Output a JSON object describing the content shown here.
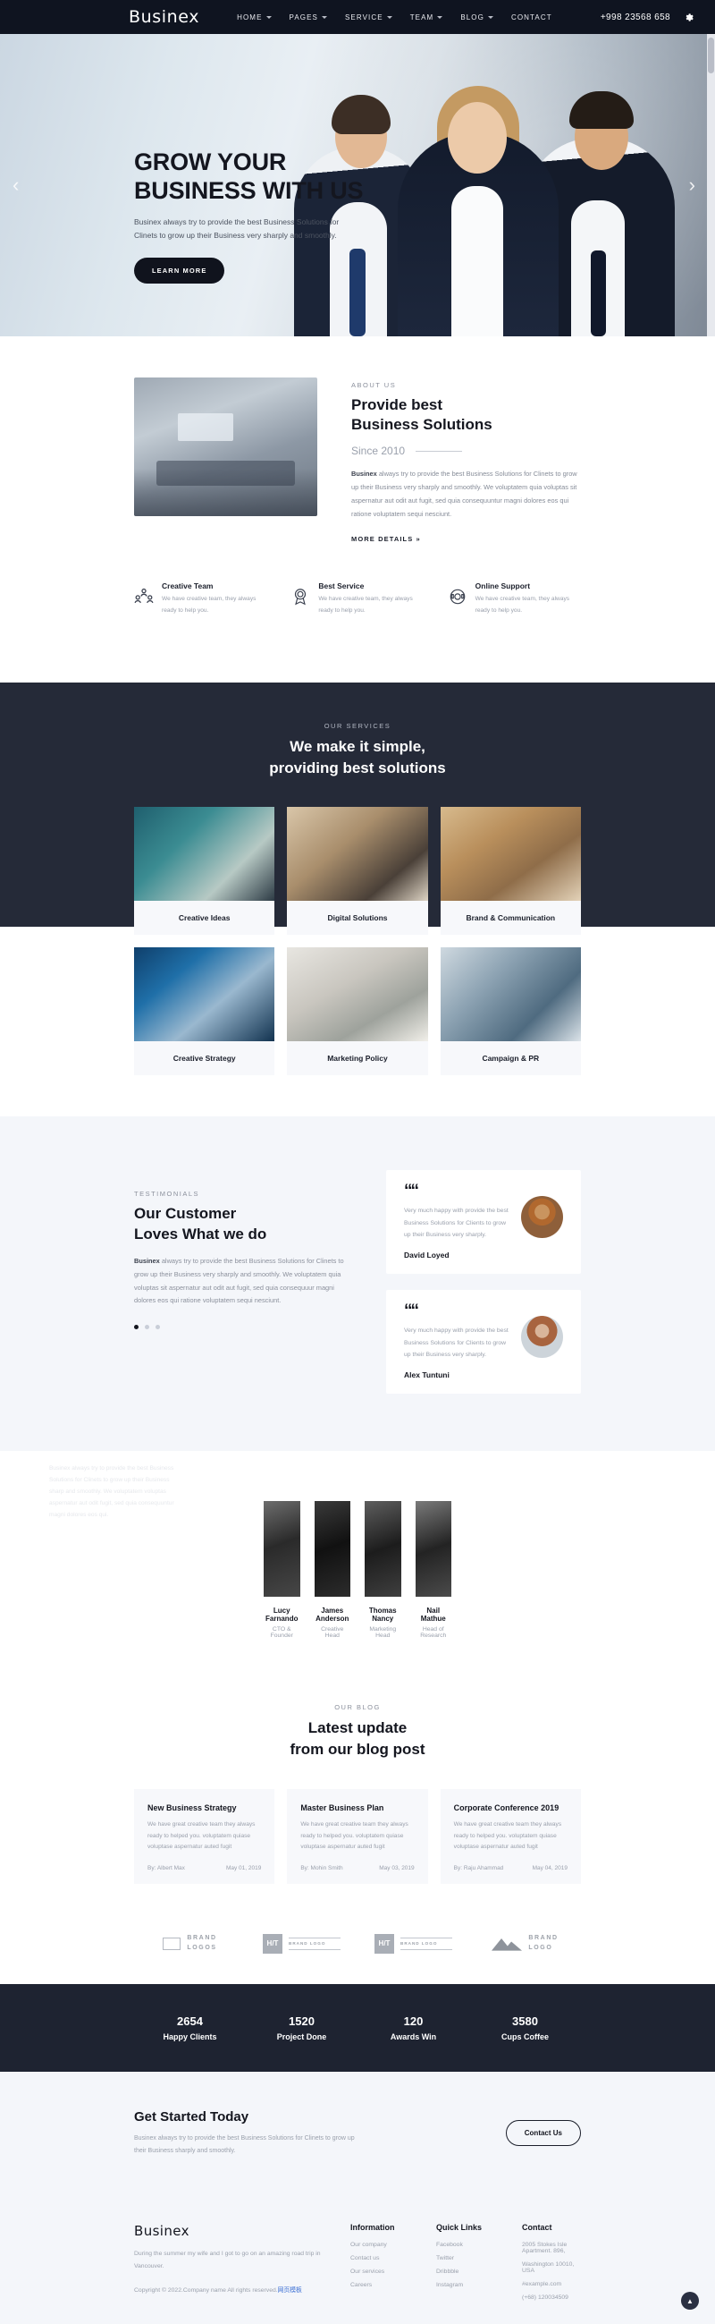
{
  "header": {
    "brand": "Businex",
    "nav": [
      {
        "label": "HOME",
        "caret": true
      },
      {
        "label": "PAGES",
        "caret": true
      },
      {
        "label": "SERVICE",
        "caret": true
      },
      {
        "label": "TEAM",
        "caret": true
      },
      {
        "label": "BLOG",
        "caret": true
      },
      {
        "label": "CONTACT",
        "caret": false
      }
    ],
    "phone": "+998 23568 658",
    "settings_icon": "gear-icon"
  },
  "hero": {
    "title_line1": "GROW YOUR",
    "title_line2": "BUSINESS WITH US",
    "paragraph": "Businex always try to provide the best Business Solutions for Clinets to grow up their Business very sharply and smoothly.",
    "button": "LEARN MORE",
    "prev_icon": "chevron-left-icon",
    "next_icon": "chevron-right-icon"
  },
  "about": {
    "eyebrow": "ABOUT US",
    "title_line1": "Provide best",
    "title_line2": "Business Solutions",
    "since": "Since 2010",
    "paragraph_bold": "Businex",
    "paragraph": " always try to provide the best Business Solutions for Clinets to grow up their Business very sharply and smoothly. We voluptatem quia voluptas sit aspernatur aut odit aut fugit, sed quia consequuntur magni dolores eos qui ratione voluptatem sequi nesciunt.",
    "more_link": "MORE DETAILS  »",
    "features": [
      {
        "icon": "team-group-icon",
        "title": "Creative Team",
        "text": "We have creative team, they always ready to help you."
      },
      {
        "icon": "award-badge-icon",
        "title": "Best Service",
        "text": "We have creative team, they always ready to help you."
      },
      {
        "icon": "support-headset-icon",
        "title": "Online Support",
        "text": "We have creative team, they always ready to help you."
      }
    ]
  },
  "services": {
    "eyebrow": "OUR SERVICES",
    "title_line1": "We make it simple,",
    "title_line2": "providing best solutions",
    "cards": [
      {
        "label": "Creative Ideas"
      },
      {
        "label": "Digital Solutions"
      },
      {
        "label": "Brand & Communication"
      },
      {
        "label": "Creative Strategy"
      },
      {
        "label": "Marketing Policy"
      },
      {
        "label": "Campaign & PR"
      }
    ]
  },
  "testimonials": {
    "eyebrow": "TESTIMONIALS",
    "title_line1": "Our Customer",
    "title_line2": "Loves What we do",
    "paragraph_bold": "Businex",
    "paragraph": " always try to provide the best Business Solutions for Clinets to grow up their Business very sharply and smoothly. We voluptatem quia voluptas sit aspernatur aut odit aut fugit, sed quia consequuur magni dolores eos qui ratione voluptatem sequi nesciunt.",
    "items": [
      {
        "quote": "Very much happy with provide the best Business Solutions for Clients to grow up their Business very sharply.",
        "name": "David Loyed"
      },
      {
        "quote": "Very much happy with provide the best Business Solutions for Clients to grow up their Business very sharply.",
        "name": "Alex Tuntuni"
      }
    ]
  },
  "team": {
    "ghost_text": "Businex always try to provide the best Business Solutions for Clinets to grow up their Business sharp and smoothly. We voluptatem voluptas aspernatur aut odit fugit, sed quia consequuntur magni dolores eos qui.",
    "members": [
      {
        "name": "Lucy Farnando",
        "role": "CTO & Founder"
      },
      {
        "name": "James Anderson",
        "role": "Creative Head"
      },
      {
        "name": "Thomas Nancy",
        "role": "Marketing Head"
      },
      {
        "name": "Nail Mathue",
        "role": "Head of Research"
      }
    ]
  },
  "blog": {
    "eyebrow": "OUR BLOG",
    "title_line1": "Latest update",
    "title_line2": "from our blog post",
    "posts": [
      {
        "title": "New Business Strategy",
        "text": "We have great creative team they always ready to helped you. voluptatem quiase voluptase aspernatur auted fugit",
        "author": "By: Albert Max",
        "date": "May 01, 2019"
      },
      {
        "title": "Master Business Plan",
        "text": "We have great creative team they always ready to helped you. voluptatem quiase voluptase aspernatur auted fugit",
        "author": "By: Mohin Smith",
        "date": "May 03, 2019"
      },
      {
        "title": "Corporate Conference 2019",
        "text": "We have great creative team they always ready to helped you. voluptatem quiase voluptase aspernatur auted fugit",
        "author": "By: Raju Ahammad",
        "date": "May 04, 2019"
      }
    ]
  },
  "brands": [
    {
      "mark": "flag-outline-icon",
      "line1": "BRAND",
      "line2": "LOGOS"
    },
    {
      "mark": "ht-square-icon",
      "badge": "H/T",
      "caption": "BRAND LOGO"
    },
    {
      "mark": "ht-square-icon",
      "badge": "H/T",
      "caption": "BRAND LOGO"
    },
    {
      "mark": "mountain-icon",
      "line1": "BRAND",
      "line2": "LOGO"
    }
  ],
  "stats": [
    {
      "number": "2654",
      "label": "Happy Clients"
    },
    {
      "number": "1520",
      "label": "Project Done"
    },
    {
      "number": "120",
      "label": "Awards Win"
    },
    {
      "number": "3580",
      "label": "Cups Coffee"
    }
  ],
  "cta": {
    "title": "Get Started Today",
    "text": "Businex always try to provide the best Business Solutions for Clinets to grow up their Business sharply and smoothly.",
    "button": "Contact Us"
  },
  "footer": {
    "brand": "Businex",
    "tagline": "During the summer my wife and I got to go on an amazing road trip in Vancouver.",
    "copyright": "Copyright © 2022.Company name All rights reserved.",
    "copyright_link": "网页模板",
    "columns": [
      {
        "title": "Information",
        "items": [
          "Our company",
          "Contact us",
          "Our services",
          "Careers"
        ]
      },
      {
        "title": "Quick Links",
        "items": [
          "Facebook",
          "Twitter",
          "Dribbble",
          "Instagram"
        ]
      },
      {
        "title": "Contact",
        "items": [
          "2005 Stokes Isle Apartment. 896,",
          "Washington 10010, USA",
          "#example.com",
          "(+68) 120034509"
        ]
      }
    ],
    "to_top_icon": "chevron-up-icon"
  },
  "colors": {
    "dark": "#1e2331",
    "services_bg": "#252a38",
    "accent_light": "#f4f6fa",
    "link": "#3b6fd4"
  }
}
